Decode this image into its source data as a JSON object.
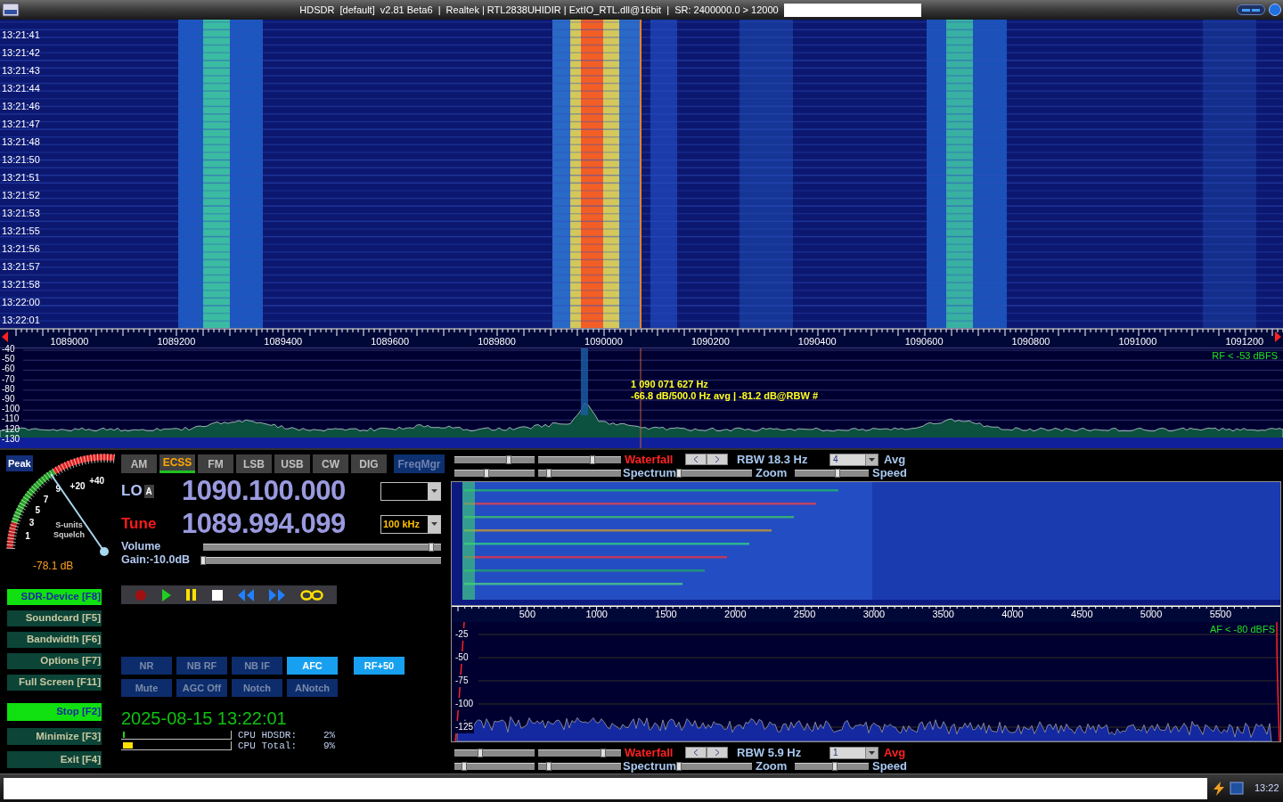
{
  "window": {
    "title": "HDSDR  [default]  v2.81 Beta6  |  Realtek | RTL2838UHIDIR | ExtIO_RTL.dll@16bit  |  SR: 2400000.0 > 12000"
  },
  "rf_waterfall": {
    "times": [
      "13:21:41",
      "13:21:42",
      "13:21:43",
      "13:21:44",
      "13:21:46",
      "13:21:47",
      "13:21:48",
      "13:21:50",
      "13:21:51",
      "13:21:52",
      "13:21:53",
      "13:21:55",
      "13:21:56",
      "13:21:57",
      "13:21:58",
      "13:22:00",
      "13:22:01"
    ]
  },
  "rf_axis": {
    "labels": [
      "1089000",
      "1089200",
      "1089400",
      "1089600",
      "1089800",
      "1090000",
      "1090200",
      "1090400",
      "1090600",
      "1090800",
      "1091000",
      "1091200"
    ]
  },
  "rf_spectrum": {
    "scale": [
      "-40",
      "-50",
      "-60",
      "-70",
      "-80",
      "-90",
      "-100",
      "-110",
      "-120",
      "-130"
    ],
    "squelch_label": "RF < -53 dBFS",
    "readout": [
      "1 090 071 627 Hz",
      "-66.8 dB/500.0 Hz avg | -81.2 dB@RBW #"
    ]
  },
  "smeter": {
    "peak_button": "Peak",
    "scale_labels": [
      "1",
      "3",
      "5",
      "7",
      "9",
      "+20",
      "+40"
    ],
    "caption": [
      "S-units",
      "Squelch"
    ],
    "reading": "-78.1 dB"
  },
  "modes": [
    {
      "label": "AM",
      "selected": false
    },
    {
      "label": "ECSS",
      "selected": true
    },
    {
      "label": "FM",
      "selected": false
    },
    {
      "label": "LSB",
      "selected": false
    },
    {
      "label": "USB",
      "selected": false
    },
    {
      "label": "CW",
      "selected": false
    },
    {
      "label": "DIG",
      "selected": false
    }
  ],
  "freqmgr_button": "FreqMgr",
  "lo": {
    "label": "LO",
    "vfo": "A",
    "frequency": "1090.100.000"
  },
  "tune": {
    "label": "Tune",
    "frequency": "1089.994.099",
    "step": "100 kHz"
  },
  "volume": {
    "label": "Volume",
    "level": 0.97
  },
  "gain": {
    "label": "Gain:-10.0dB",
    "level": 0.0
  },
  "side_buttons": [
    {
      "label": "SDR-Device",
      "key": "[F8]",
      "on": true
    },
    {
      "label": "Soundcard",
      "key": "[F5]",
      "on": false
    },
    {
      "label": "Bandwidth",
      "key": "[F6]",
      "on": false
    },
    {
      "label": "Options",
      "key": "[F7]",
      "on": false
    },
    {
      "label": "Full Screen",
      "key": "[F11]",
      "on": false
    },
    {
      "label": "Stop",
      "key": "[F2]",
      "on": true
    },
    {
      "label": "Minimize",
      "key": "[F3]",
      "on": false
    },
    {
      "label": "Exit",
      "key": "[F4]",
      "on": false
    }
  ],
  "dsp_buttons": [
    {
      "label": "NR",
      "on": false
    },
    {
      "label": "NB RF",
      "on": false
    },
    {
      "label": "NB IF",
      "on": false
    },
    {
      "label": "AFC",
      "on": true
    },
    {
      "label": "RF+50",
      "on": true
    },
    {
      "label": "Mute",
      "on": false
    },
    {
      "label": "AGC Off",
      "on": false
    },
    {
      "label": "Notch",
      "on": false
    },
    {
      "label": "ANotch",
      "on": false
    }
  ],
  "clock": "2025-08-15 13:22:01",
  "cpu": [
    {
      "label": "CPU HDSDR:",
      "value": "2%",
      "level": 0.02
    },
    {
      "label": "CPU Total:",
      "value": "9%",
      "level": 0.09
    }
  ],
  "rf_controls": {
    "waterfall": "Waterfall",
    "spectrum": "Spectrum",
    "rbw": "RBW 18.3 Hz",
    "zoom": "Zoom",
    "avg_value": "4",
    "avg": "Avg",
    "avg_on": false,
    "speed": "Speed",
    "sliders": [
      {
        "level": 0.69
      },
      {
        "level": 0.67
      },
      {
        "level": 0.39
      },
      {
        "level": 0.1
      },
      {
        "level": 0.0
      },
      {
        "level": 0.58
      }
    ]
  },
  "af_axis": {
    "labels": [
      "500",
      "1000",
      "1500",
      "2000",
      "2500",
      "3000",
      "3500",
      "4000",
      "4500",
      "5000",
      "5500"
    ]
  },
  "af_spectrum": {
    "scale": [
      "-25",
      "-50",
      "-75",
      "-100",
      "-125"
    ],
    "squelch_label": "AF < -80 dBFS"
  },
  "af_controls": {
    "waterfall": "Waterfall",
    "spectrum": "Spectrum",
    "rbw": "RBW 5.9 Hz",
    "zoom": "Zoom",
    "avg_value": "1",
    "avg": "Avg",
    "avg_on": true,
    "speed": "Speed",
    "sliders": [
      {
        "level": 0.31
      },
      {
        "level": 0.81
      },
      {
        "level": 0.1
      },
      {
        "level": 0.1
      },
      {
        "level": 0.0
      },
      {
        "level": 0.54
      }
    ]
  },
  "taskbar": {
    "clock": "13:22"
  }
}
